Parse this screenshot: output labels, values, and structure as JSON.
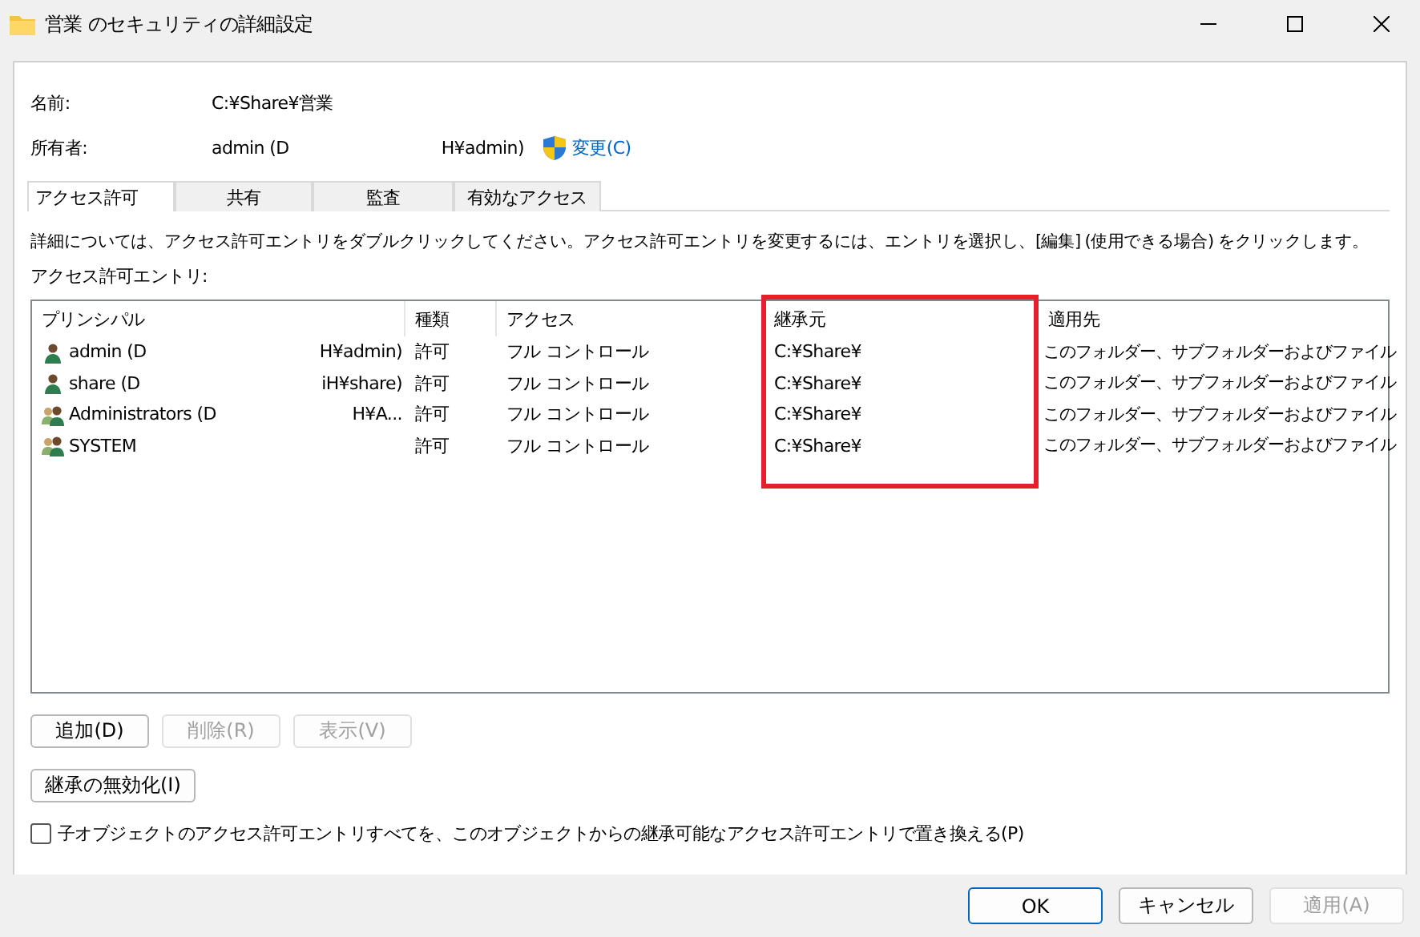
{
  "window": {
    "title": "営業 のセキュリティの詳細設定"
  },
  "fields": [
    {
      "label": "名前:",
      "value": "C:¥Share¥営業"
    },
    {
      "label": "所有者:",
      "value": "admin (D",
      "value_tail": "H¥admin)",
      "link": "変更(C)"
    }
  ],
  "tabs": [
    {
      "label": "アクセス許可",
      "selected": true
    },
    {
      "label": "共有",
      "selected": false
    },
    {
      "label": "監査",
      "selected": false
    },
    {
      "label": "有効なアクセス",
      "selected": false
    }
  ],
  "instruction": "詳細については、アクセス許可エントリをダブルクリックしてください。アクセス許可エントリを変更するには、エントリを選択し、[編集] (使用できる場合) をクリックします。",
  "list_label": "アクセス許可エントリ:",
  "table": {
    "columns": [
      {
        "label": "プリンシパル",
        "highlighted": false
      },
      {
        "label": "種類",
        "highlighted": false
      },
      {
        "label": "アクセス",
        "highlighted": false
      },
      {
        "label": "継承元",
        "highlighted": true
      },
      {
        "label": "適用先",
        "highlighted": false
      }
    ],
    "rows": [
      {
        "kind": "user",
        "principal": "admin (D",
        "principal_tail": "H¥admin)",
        "type": "許可",
        "access": "フル コントロール",
        "inherited_from": "C:¥Share¥",
        "applies_to": "このフォルダー、サブフォルダーおよびファイル"
      },
      {
        "kind": "user",
        "principal": "share (D",
        "principal_tail": "iH¥share)",
        "type": "許可",
        "access": "フル コントロール",
        "inherited_from": "C:¥Share¥",
        "applies_to": "このフォルダー、サブフォルダーおよびファイル"
      },
      {
        "kind": "group",
        "principal": "Administrators (D",
        "principal_tail": "H¥A...",
        "type": "許可",
        "access": "フル コントロール",
        "inherited_from": "C:¥Share¥",
        "applies_to": "このフォルダー、サブフォルダーおよびファイル"
      },
      {
        "kind": "group",
        "principal": "SYSTEM",
        "type": "許可",
        "access": "フル コントロール",
        "inherited_from": "C:¥Share¥",
        "applies_to": "このフォルダー、サブフォルダーおよびファイル"
      }
    ]
  },
  "entry_buttons": [
    {
      "label": "追加(D)",
      "disabled": false
    },
    {
      "label": "削除(R)",
      "disabled": true
    },
    {
      "label": "表示(V)",
      "disabled": true
    }
  ],
  "inheritance_button": "継承の無効化(I)",
  "replace_checkbox": {
    "label": "子オブジェクトのアクセス許可エントリすべてを、このオブジェクトからの継承可能なアクセス許可エントリで置き換える(P)",
    "checked": false
  },
  "dialog_buttons": [
    {
      "label": "OK",
      "disabled": false,
      "default": true
    },
    {
      "label": "キャンセル",
      "disabled": false,
      "default": false
    },
    {
      "label": "適用(A)",
      "disabled": true,
      "default": false
    }
  ]
}
